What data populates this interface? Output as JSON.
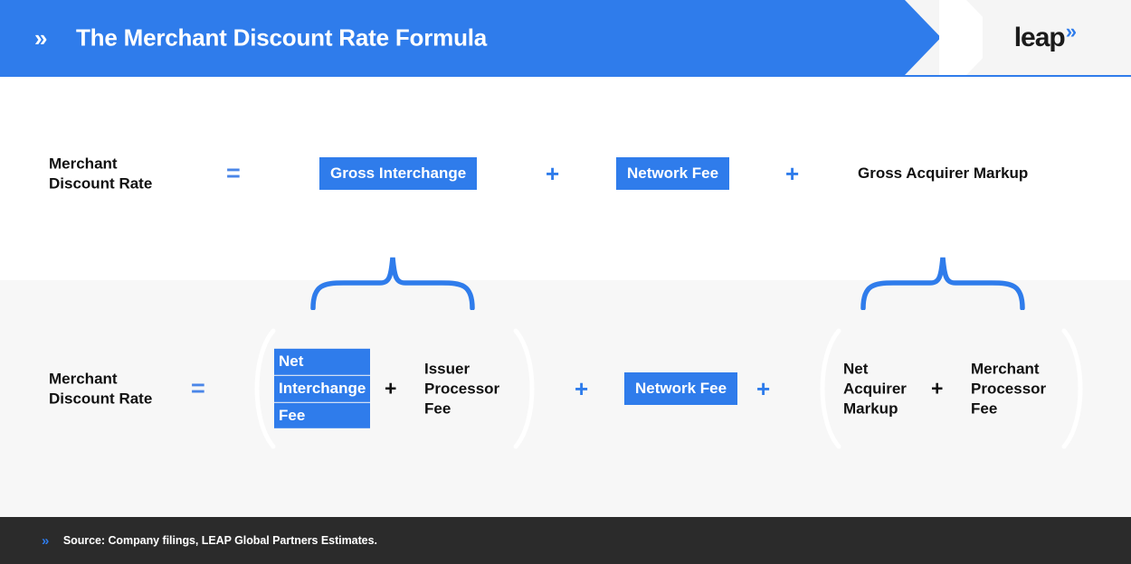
{
  "header": {
    "chevron_icon": "double-chevron-right",
    "title": "The Merchant Discount Rate Formula",
    "logo_word": "leap",
    "logo_mark": "»",
    "bar_color": "#2f7ceb",
    "bg_color": "#f5f5f5"
  },
  "row1": {
    "label": "Merchant\nDiscount Rate",
    "equals": "=",
    "term1": "Gross Interchange",
    "op1": "+",
    "term2": "Network Fee",
    "op2": "+",
    "term3": "Gross Acquirer Markup"
  },
  "row2": {
    "label": "Merchant\nDiscount Rate",
    "equals": "=",
    "group1": {
      "term1_line1": "Net",
      "term1_line2": "Interchange",
      "term1_line3": "Fee",
      "inner_op": "+",
      "term2": "Issuer\nProcessor\nFee"
    },
    "op1": "+",
    "term_network": "Network Fee",
    "op2": "+",
    "group2": {
      "term1": "Net\nAcquirer\nMarkup",
      "inner_op": "+",
      "term2": "Merchant\nProcessor\nFee"
    }
  },
  "braces": {
    "left_label": "brace-over-net-interchange-group",
    "right_label": "brace-over-net-acquirer-group",
    "color": "#2f7ceb"
  },
  "footer": {
    "chevron_icon": "double-chevron-right",
    "source": "Source: Company filings, LEAP Global Partners Estimates.",
    "bg_color": "#2b2b2b"
  },
  "colors": {
    "accent_blue": "#2f7ceb",
    "equals_blue": "#4a86e8",
    "text_black": "#111111",
    "band_gray": "#f7f7f7"
  }
}
